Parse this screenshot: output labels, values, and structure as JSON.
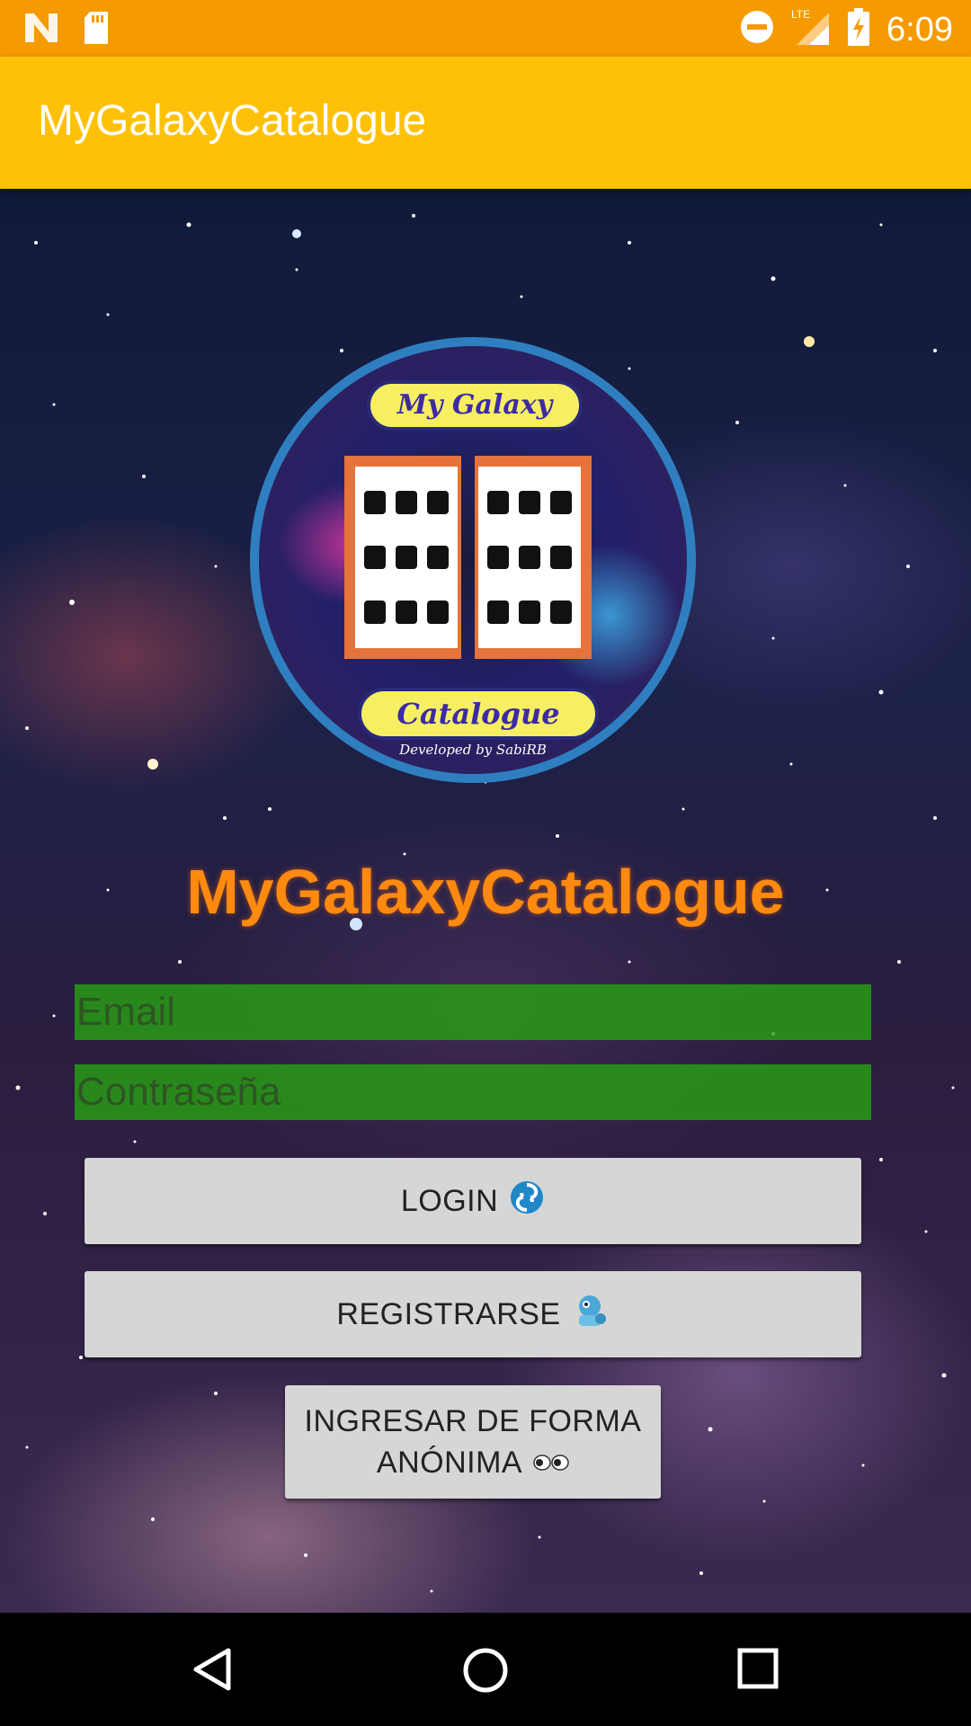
{
  "status_bar": {
    "time": "6:09",
    "network": "LTE",
    "left_icons": [
      "n-logo-icon",
      "sd-card-icon"
    ],
    "right_icons": [
      "do-not-disturb-icon",
      "signal-lte-icon",
      "battery-charging-icon"
    ],
    "color": "#f59a00"
  },
  "app_bar": {
    "title": "MyGalaxyCatalogue",
    "color": "#ffc107"
  },
  "logo": {
    "banner_top": "My Galaxy",
    "banner_bottom": "Catalogue",
    "developer": "Developed by SabiRB"
  },
  "brand_title": "MyGalaxyCatalogue",
  "form": {
    "email_placeholder": "Email",
    "email_value": "",
    "password_placeholder": "Contraseña",
    "password_value": ""
  },
  "buttons": {
    "login": "LOGIN",
    "register": "REGISTRARSE",
    "anon_line1": "INGRESAR DE FORMA",
    "anon_line2": "ANÓNIMA",
    "login_icon": "cyclone-icon",
    "register_icon": "robot-icon",
    "anon_icon": "eyes-icon"
  },
  "nav_bar": {
    "items": [
      "back-icon",
      "home-icon",
      "recents-icon"
    ]
  }
}
